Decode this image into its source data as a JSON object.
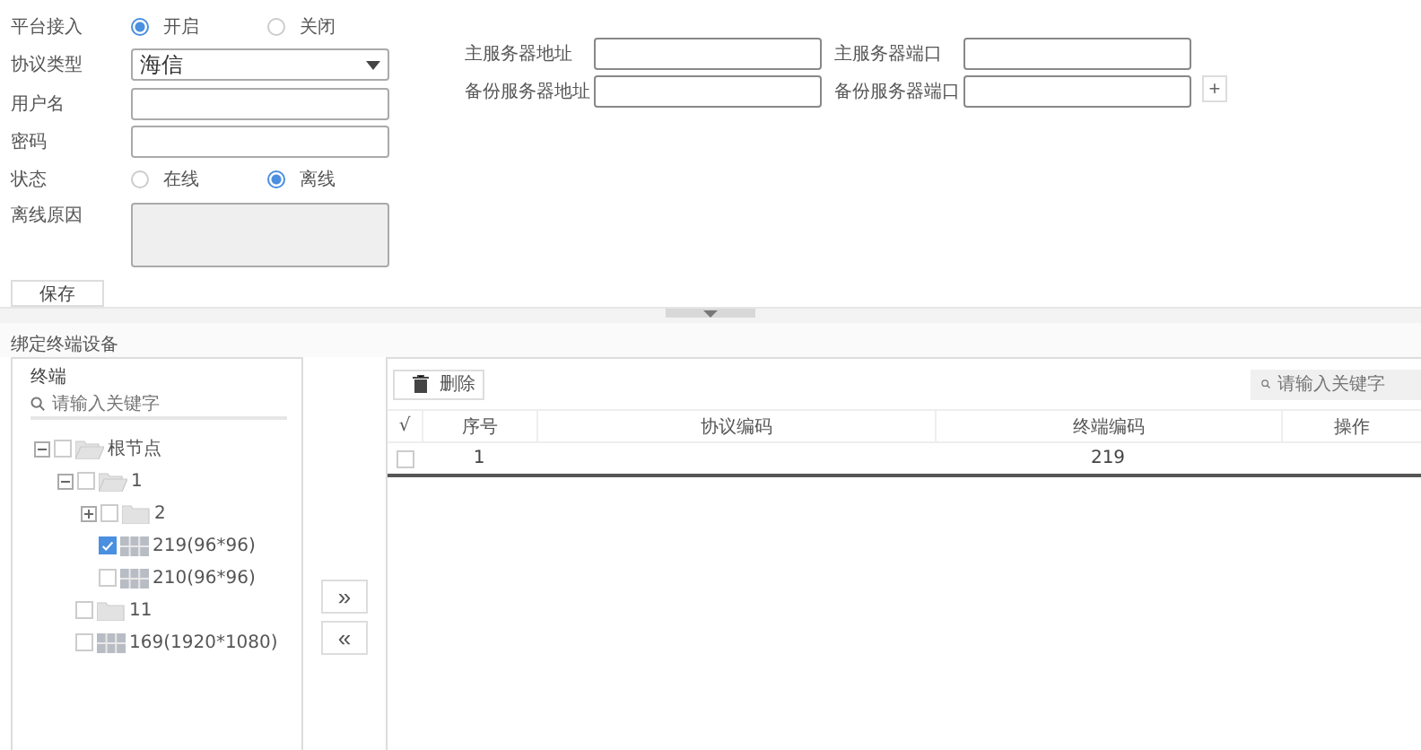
{
  "platform_access": {
    "label": "平台接入",
    "options": [
      {
        "label": "开启",
        "selected": true
      },
      {
        "label": "关闭",
        "selected": false
      }
    ]
  },
  "protocol_type": {
    "label": "协议类型",
    "value": "海信"
  },
  "username": {
    "label": "用户名"
  },
  "password": {
    "label": "密码"
  },
  "status": {
    "label": "状态",
    "options": [
      {
        "label": "在线",
        "selected": false
      },
      {
        "label": "离线",
        "selected": true
      }
    ]
  },
  "offline_reason": {
    "label": "离线原因",
    "disabled": true
  },
  "save_button": "保存",
  "servers": [
    {
      "label": "主服务器地址"
    },
    {
      "label": "主服务器端口"
    },
    {
      "label": "备份服务器地址"
    },
    {
      "label": "备份服务器端口"
    }
  ],
  "add_button": "+",
  "section_title": "绑定终端设备",
  "tree": {
    "title": "终端",
    "search_placeholder": "请输入关键字",
    "nodes": [
      {
        "label": "根节点",
        "kind": "folder",
        "checked": false,
        "expanded": true,
        "children": [
          {
            "label": "1",
            "kind": "folder",
            "checked": false,
            "expanded": true,
            "children": [
              {
                "label": "2",
                "kind": "folder",
                "checked": false,
                "expanded": false
              },
              {
                "label": "219(96*96)",
                "kind": "screen",
                "checked": true
              },
              {
                "label": "210(96*96)",
                "kind": "screen",
                "checked": false
              }
            ]
          },
          {
            "label": "11",
            "kind": "folder",
            "checked": false
          },
          {
            "label": "169(1920*1080)",
            "kind": "screen",
            "checked": false
          }
        ]
      }
    ]
  },
  "transfer_buttons": [
    "»",
    "«"
  ],
  "table": {
    "delete_button": "删除",
    "search_placeholder": "请输入关键字",
    "columns": [
      "√",
      "序号",
      "协议编码",
      "终端编码",
      "操作"
    ],
    "rows": [
      {
        "checked": false,
        "index": "1",
        "terminal_code": "219"
      }
    ]
  }
}
